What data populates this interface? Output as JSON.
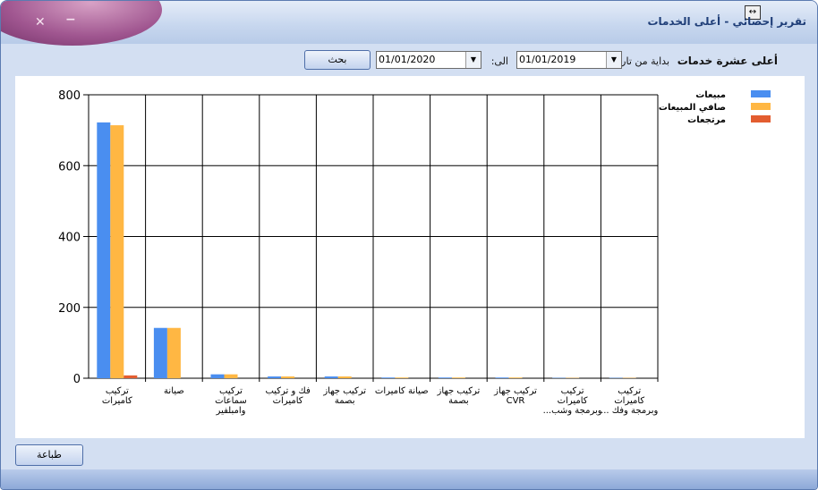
{
  "window": {
    "title": "تقرير إحصائي - أعلى الخدمات",
    "close_glyph": "✕",
    "minimize_glyph": "−",
    "resize_glyph": "↔"
  },
  "toolbar": {
    "heading": "أعلى عشرة خدمات",
    "from_label": "بداية من تاريخ:",
    "from_value": "01/01/2019",
    "to_label": "الى:",
    "to_value": "01/01/2020",
    "search_label": "بحث"
  },
  "footer": {
    "print_label": "طباعة"
  },
  "chart_data": {
    "type": "bar",
    "ylim": [
      0,
      800
    ],
    "yticks": [
      0,
      200,
      400,
      600,
      800
    ],
    "grid": true,
    "legend_position": "top-right",
    "categories": [
      [
        "تركيب",
        "كاميرات"
      ],
      [
        "صيانة"
      ],
      [
        "تركيب",
        "سماعات",
        "وامبلفير"
      ],
      [
        "فك و تركيب",
        "كاميرات"
      ],
      [
        "تركيب جهاز",
        "بصمة"
      ],
      [
        "صيانة كاميرات"
      ],
      [
        "تركيب جهاز",
        "بصمة"
      ],
      [
        "تركيب جهاز",
        "CVR"
      ],
      [
        "تركيب",
        "كاميرات",
        "وبرمجة وشب..."
      ],
      [
        "تركيب",
        "كاميرات",
        "وبرمجة وفك ..."
      ]
    ],
    "series": [
      {
        "name": "مبيعات",
        "color": "#4a8ef0",
        "values": [
          722,
          142,
          11,
          5,
          5,
          2,
          2,
          2,
          1,
          1
        ]
      },
      {
        "name": "صافي المبيعات",
        "color": "#ffb743",
        "values": [
          714,
          142,
          11,
          5,
          5,
          2,
          2,
          2,
          1,
          1
        ]
      },
      {
        "name": "مرتجعات",
        "color": "#e35d30",
        "values": [
          8,
          0,
          0,
          0,
          0,
          0,
          0,
          0,
          0,
          0
        ]
      }
    ]
  }
}
